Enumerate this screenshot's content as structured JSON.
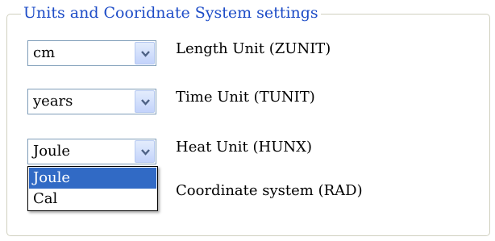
{
  "groupbox": {
    "title": "Units and Cooridnate System settings",
    "accent_color": "#1d4cc7"
  },
  "fields": [
    {
      "label": "Length Unit (ZUNIT)",
      "value": "cm"
    },
    {
      "label": "Time Unit (TUNIT)",
      "value": "years"
    },
    {
      "label": "Heat Unit (HUNX)",
      "value": "Joule"
    },
    {
      "label": "Coordinate system (RAD)"
    }
  ],
  "heat_dropdown": {
    "options": [
      "Joule",
      "Cal"
    ],
    "highlighted": "Joule",
    "highlight_color": "#316ac5"
  },
  "icons": {
    "combo_button": "chevron-down-icon"
  }
}
